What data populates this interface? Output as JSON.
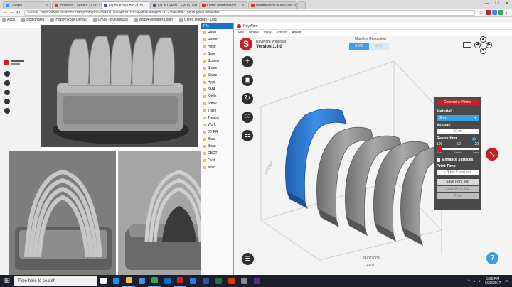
{
  "browser": {
    "tabs": [
      {
        "title": "Google",
        "color": "#4285f4",
        "active": false
      },
      {
        "title": "formlabs - Search - Cur",
        "color": "#d24726",
        "active": false
      },
      {
        "title": "(2) Blue Sky Bio - CBCT",
        "color": "#3b5998",
        "active": true
      },
      {
        "title": "(2) 3D PRINT FRUSTRA",
        "color": "#3b5998",
        "active": false
      },
      {
        "title": "Order Mouthwatch",
        "color": "#d93025",
        "active": false
      },
      {
        "title": "Mouthwatch.rx.McGinn",
        "color": "#d93025",
        "active": false
      }
    ],
    "window_controls": [
      "—",
      "❐",
      "✕"
    ],
    "secure_label": "Secure",
    "url": "https://www.facebook.com/photo.php?fbid=1010654539153156986&set=pcb.1112399698871580&type=3&theater",
    "bookmarks": [
      "Apps",
      "Bookmarks",
      "Happy Rock Dental",
      "Gmail - BOutlet005",
      "BSBA-Member Login",
      "Cerec Doctors - Disc"
    ]
  },
  "explorer": {
    "header": "File",
    "items": [
      "Rand",
      "Rando",
      "Hinof",
      "Servi",
      "Screen",
      "Share",
      "Share",
      "Hygi",
      "SMA",
      "Smile",
      "Softw",
      "Traini",
      "Treatm",
      "Work",
      "3D PR",
      "Blue",
      "Brian",
      "CBCT",
      "Cust",
      "Misc"
    ]
  },
  "rayware": {
    "window_title": "RayWare",
    "menu": [
      "File",
      "Model",
      "View",
      "Printer",
      "About"
    ],
    "brand_name": "RayWare Windows",
    "brand_version": "Version 1.3.0",
    "machine_resolution_label": "Machine Resolution",
    "resolution_options": [
      "S100",
      "S200"
    ],
    "front_label": "FRONT",
    "panel": {
      "connect_label": "Connect A Printer",
      "material_label": "Material",
      "material_value": "Grey",
      "volume_label": "Volume",
      "volume_value": "62 ml",
      "resolution_label": "Resolution",
      "resolution_ticks": [
        "100",
        "50",
        "20"
      ],
      "resolution_names": [
        "Fast",
        "Better",
        "Best"
      ],
      "resolution_fraction": 0.05,
      "enhance_label": "Enhance Surfaces",
      "print_time_label": "Print Time",
      "print_time_value": "~ 3 hrs 5 minutes",
      "save_job_label": "Save Print Job",
      "load_job_label": "Load Print Job",
      "print_label": "Print"
    },
    "status_date": "26/027008",
    "status_volume": "10 ml"
  },
  "colors": {
    "accent_red": "#c62127",
    "accent_blue": "#3d9ee0",
    "model_grey": "#8c8c8c",
    "model_selected": "#2f7fd8"
  },
  "taskbar": {
    "search_placeholder": "Type here to search",
    "apps": [
      {
        "icon": "task-view-icon",
        "color": "#ffffff",
        "open": false
      },
      {
        "icon": "edge-icon",
        "color": "#1e90ff",
        "open": false
      },
      {
        "icon": "file-explorer-icon",
        "color": "#f0c14b",
        "open": true
      },
      {
        "icon": "store-icon",
        "color": "#4a90d9",
        "open": false
      },
      {
        "icon": "chrome-icon",
        "color": "#34a853",
        "open": true
      },
      {
        "icon": "outlook-icon",
        "color": "#0072c6",
        "open": false
      },
      {
        "icon": "rayware-icon",
        "color": "#c62127",
        "open": true
      },
      {
        "icon": "photos-icon",
        "color": "#2d7dd2",
        "open": false
      },
      {
        "icon": "word-icon",
        "color": "#2b579a",
        "open": false
      },
      {
        "icon": "excel-icon",
        "color": "#217346",
        "open": false
      },
      {
        "icon": "app-icon",
        "color": "#d83b01",
        "open": false
      },
      {
        "icon": "app-icon",
        "color": "#888888",
        "open": false
      },
      {
        "icon": "app-icon",
        "color": "#5c2d91",
        "open": false
      }
    ],
    "time": "3:28 PM",
    "date": "6/28/2017"
  }
}
